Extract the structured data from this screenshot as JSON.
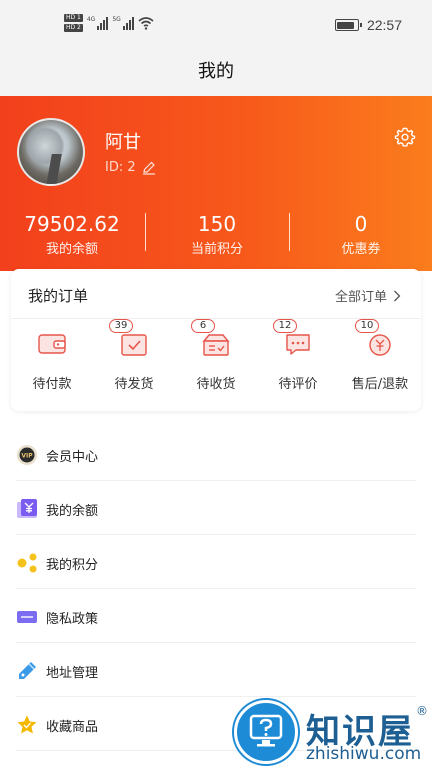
{
  "status_bar": {
    "hd_top": "HD 1",
    "hd_bottom": "HD 2",
    "network_1": "4G",
    "network_2": "5G",
    "time": "22:57",
    "battery_level": 0.85
  },
  "nav": {
    "title": "我的"
  },
  "profile": {
    "name": "阿甘",
    "id_label": "ID: 2",
    "stats": [
      {
        "value": "79502.62",
        "label": "我的余额"
      },
      {
        "value": "150",
        "label": "当前积分"
      },
      {
        "value": "0",
        "label": "优惠券"
      }
    ]
  },
  "orders": {
    "title": "我的订单",
    "all_label": "全部订单",
    "items": [
      {
        "label": "待付款",
        "icon": "wallet-icon",
        "badge": ""
      },
      {
        "label": "待发货",
        "icon": "shipping-box-icon",
        "badge": "39"
      },
      {
        "label": "待收货",
        "icon": "receive-box-icon",
        "badge": "6"
      },
      {
        "label": "待评价",
        "icon": "comment-icon",
        "badge": "12"
      },
      {
        "label": "售后/退款",
        "icon": "refund-icon",
        "badge": "10"
      }
    ]
  },
  "menu": [
    {
      "label": "会员中心",
      "icon": "vip-icon",
      "color": "#2b2b2b"
    },
    {
      "label": "我的余额",
      "icon": "yuan-icon",
      "color": "#7b5cf0"
    },
    {
      "label": "我的积分",
      "icon": "points-icon",
      "color": "#f5c21b"
    },
    {
      "label": "隐私政策",
      "icon": "policy-icon",
      "color": "#7b6cf2"
    },
    {
      "label": "地址管理",
      "icon": "address-icon",
      "color": "#3a9ae8"
    },
    {
      "label": "收藏商品",
      "icon": "star-icon",
      "color": "#f5b800"
    }
  ],
  "watermark": {
    "brand": "知识屋",
    "reg_mark": "®",
    "domain": "zhishiwu.com"
  },
  "colors": {
    "accent": "#f2401c",
    "accent_end": "#fb7d1c",
    "badge_border": "#e5554a"
  }
}
